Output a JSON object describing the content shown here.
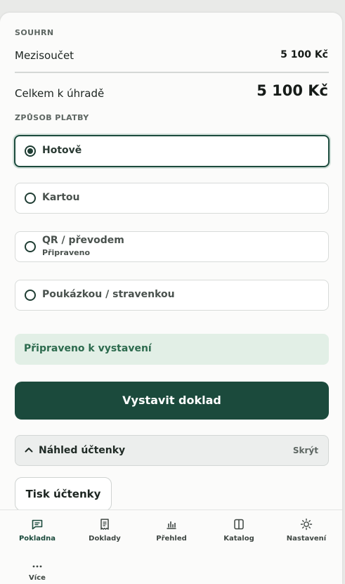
{
  "summary": {
    "heading": "SOUHRN",
    "subtotal_label": "Mezisoučet",
    "subtotal_value": "5 100 Kč",
    "total_label": "Celkem k úhradě",
    "total_value": "5 100 Kč"
  },
  "payment": {
    "heading": "ZPŮSOB PLATBY",
    "options": [
      {
        "label": "Hotově",
        "sublabel": "",
        "selected": true
      },
      {
        "label": "Kartou",
        "sublabel": "",
        "selected": false
      },
      {
        "label": "QR / převodem",
        "sublabel": "Připraveno",
        "selected": false
      },
      {
        "label": "Poukázkou / stravenkou",
        "sublabel": "",
        "selected": false
      }
    ]
  },
  "status": {
    "text": "Připraveno k vystavení"
  },
  "actions": {
    "issue_label": "Vystavit doklad",
    "print_label": "Tisk účtenky"
  },
  "receipt_preview": {
    "title": "Náhled účtenky",
    "hide_label": "Skrýt"
  },
  "nav": {
    "items": [
      {
        "label": "Pokladna",
        "icon": "message-square-icon",
        "active": true
      },
      {
        "label": "Doklady",
        "icon": "receipt-icon",
        "active": false
      },
      {
        "label": "Přehled",
        "icon": "bar-chart-icon",
        "active": false
      },
      {
        "label": "Katalog",
        "icon": "columns-icon",
        "active": false
      },
      {
        "label": "Nastavení",
        "icon": "sun-icon",
        "active": false
      },
      {
        "label": "Více",
        "icon": "more-icon",
        "active": false
      }
    ]
  },
  "colors": {
    "accent": "#1b4a3c",
    "status_bg": "#e2efe6",
    "status_text": "#2d6b4e"
  }
}
